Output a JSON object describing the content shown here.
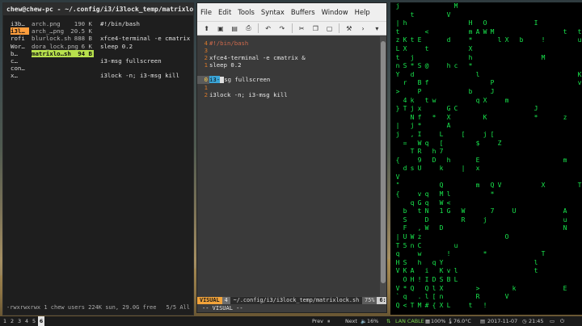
{
  "terminal": {
    "title": "chew@chew-pc - ~/.config/i3/i3lock_temp/matrixlock.sh",
    "parent_dirs": [
      "i3b…",
      "i3l…",
      "rofi",
      "Wor…",
      "b…",
      "c…",
      "con…",
      "x…"
    ],
    "files": [
      {
        "name": "arch.png",
        "size": "190 K",
        "selected": false
      },
      {
        "name": "arch_…png",
        "size": "20.5 K",
        "selected": false
      },
      {
        "name": "blurlock.sh",
        "size": "888 B",
        "selected": false
      },
      {
        "name": "dora_lock.png",
        "size": "6 K",
        "selected": false
      },
      {
        "name": "matrixlo…sh",
        "size": "94 B",
        "selected": true
      }
    ],
    "preview": [
      "#!/bin/bash",
      "",
      "xfce4-terminal -e cmatrix",
      "sleep 0.2",
      "",
      "i3-msg fullscreen",
      "",
      "i3lock -n; i3-msg kill"
    ],
    "status_left": "-rwxrwxrwx 1 chew users 224K sun, 29.0G free",
    "status_right": "5/5  All"
  },
  "vim": {
    "menu": [
      "File",
      "Edit",
      "Tools",
      "Syntax",
      "Buffers",
      "Window",
      "Help"
    ],
    "toolbar": [
      "open-icon",
      "save-icon",
      "save-all-icon",
      "print-icon",
      "undo-icon",
      "redo-icon",
      "cut-icon",
      "copy-icon",
      "paste-icon",
      "find-replace-icon",
      "forward-icon",
      "dropdown-icon"
    ],
    "lines": [
      {
        "num": "4",
        "text": "#!/bin/bash",
        "comment": true
      },
      {
        "num": "3",
        "text": ""
      },
      {
        "num": "2",
        "text": "xfce4-terminal -e cmatrix &"
      },
      {
        "num": "1",
        "text": "sleep 0.2"
      },
      {
        "num": "0",
        "sel": "i3-",
        "rest": "sg fullscreen"
      },
      {
        "num": "1",
        "text": ""
      },
      {
        "num": "2",
        "text": "i3lock -n; i3-msg kill"
      }
    ],
    "status": {
      "mode": "VISUAL",
      "num": "4",
      "file": "~/.config/i3/i3lock_temp/matrixlock.sh",
      "pct": "75%",
      "enc": "",
      "pos": "6:4"
    },
    "cmdline": "-- VISUAL --"
  },
  "matrix_columns": [
    "j\n\n|\nt\nz\nL\nt\nn\nY\n\n>\n \n}\n \n|\nj\n \n\n{\n \nV\n\"\n{\n\n \n\n\n|\nT\nq\nH\nV\n \nV\n`\nQ",
    "\n\nh\n\nK\nX\n\nS\n \nr\n\n4\nT\n \n \n\n=\n \n\nd\n\n\n\n \nb\nS\nF\nU\n5\n \nS\nK\nO\n*\nq\n<",
    "\nt\n\n\nt\n\nj\n*\nd\n\n\nk\nj\nN\nj\n,\n \nT\n\ns\n\n\n\nq\n\n\n\nW\nn\n\n\nA\nH\nQ\n \nT",
    "\n\n\n \nE\n \n \nS\n\nB\nP\n \nx\nf\n*\nI\nW\nR\n9\nU\n\n\nv\nG\nt\n\n,\nz\nC\nw\nh\n\n!\n\n.\nM",
    "\n \n\n<\n\nt\n\n@\n\nf\n \nt\n\n\n \n \nq\n \n\n\n\n\nq\nq\nN\nD\nW\n\n\n\n \ni\nI\nQ\nl\n#",
    "\n\n\n\n\n\n\n\n \n\n \nw\n \n*\n \n \n \nh\nD\n\n\n \n\n \n\n\n\n\n\n\nq\n\nD\nl\n[\n{",
    "\n\n\n\n \n\n\n \n\n \n \n \n\n \n \nL\n[\n7\n \nk\n\nQ\nM\nW\n1\n \nD\n\n\n \nY\nK\nS\nX\nn\nX",
    "\nV\n\n\nd\n \n\nh\n \n \n\n\nG\nX\nA\n\n\n\nh\n\n \n \nl\n<\nG\n\n\n\n\n!\n \nv\nB\n\n\nL",
    "M\n\n \n \n\n \n\nc\n\n\n\n \nC\n\n\n\n\n\n\n \n\n\n\n\n\n\n \n\nu\n\n\nl\nL\n\n\n\n",
    "\n\n \n\n\n\n\n\n \n\n \n \n \n \n \n[\n \n\n \n|\n\n\n \n \nW\nR\n\n \n\n \n\n\n \n \n \n",
    "\n\nH\nm\n*\nX\nh\n*\n\n \nb\n \n \n\n\n\n\n\n\n\n\n \n\n\n \n\n\n\n \n\n\n \n\n\n\nt",
    "\n \n\nA\n\n\n \n\nl\n\n \nq\n \n\n \n\n$\n \nE\nx\n\nm\n \n\n \n\n\n\n\n\n \n\n\n>\nR\n\n",
    "\n \nO\nW\n\n\n\n\n\n\n \nX\n \nK\n \nj\n \n \n\n\n \n\n\n\n \nj\n\n \n \n*\n\n\n \n\n \n!",
    "\n\n\nM\n\n \n\n\n\nP\nJ\n \n\n\n \n[\n\n \n\n\n\nQ\n*\n \n7\n\n \n\n \n\n\n\n\n \n",
    "\n \n \n\nl\n\n \n\n\n\n \n\n\n\n\n \nZ\n\n\n\n \nV\n\n\n\n \n\n\n\n\n\n \n\n\n\n",
    "\n\n\n \nX\n \n\n\n \n \n \nm\n\n\n\n\n\n \n\n\n \n\n\n\n \n\n\nO\n \n \n\n\n\n\nV\n",
    "\n\n \n\n \n \n \n\n\n \n\n\n \n \n \n \n\n\n\n \n\n\n \n\nU\n\n\n\n \n\n \n\n\nk\n\n",
    "\n\n \n\nb\n\n \n\n\n\n \n\n\n \n \n \n \n\n\n\n\n \n\n \n\n \n \n\n\n\n\n\n \n\n\n",
    "\n \n \n\n\n \n \n\n \n\n \n\n \n\n \n\n \n\n\n \n \n\n\n\n \n \n \n\n \n \n \n\n\n",
    "\n\nI\n \n\n\n \n\n \n\n\n \nJ\n*\n \n\n\n\n \n \n\n \n \n\n\n \n\n\n\n \nl\nt\n\n \n\n",
    "\n\n \n \n!\n \nM\n \n\n\n \n\n\n \n\n\n\n \n\n\n\nX\n\n\n\n \n\n\n\nT\n\n\n \n\n\n",
    "\n\n\n \n\n \n\n\n\n \n\n\n \n\n \n \n \n\n\n \n\n\n\n \n \n\n \n\n\n \n\n\n\n\n",
    "\n\n\n \n \n\n\n\n \n \n\n\n\n\n \n\n\n\n \n\n\n \n\n\n\n\n \n\n\n \n\n\n \n\n",
    "\n\n\nt\n\n\n\n\n\n\n\n\n \nz\n\n\n\n\nm\n\n\n\n\n\nA\nu\nN\n\n\n\n\n \n\nE\n\n",
    "\n \n \n \n\n\n \n\n\n\n\n \n\n\n\n\n\n\n\n\n\n \n \n\n \n\n \n \n\n\n \n\n\n\n",
    "\n\n\nt\nu\n\n \n\nK\nv\n\n\n \n \n \n\n\n\n \n \n\nT\n \n \n\n\n\n \n\n \n\n\n\n\n"
  ],
  "bar": {
    "workspaces": [
      "1",
      "2",
      "3",
      "4",
      "5",
      "6"
    ],
    "active_workspace": "6",
    "prev": "Prev",
    "next": "Next",
    "volume": "16%",
    "network": "LAN CABLE",
    "cpu": "100%",
    "temp": "76.0°C",
    "date": "2017-11-07",
    "time": "21:45"
  }
}
